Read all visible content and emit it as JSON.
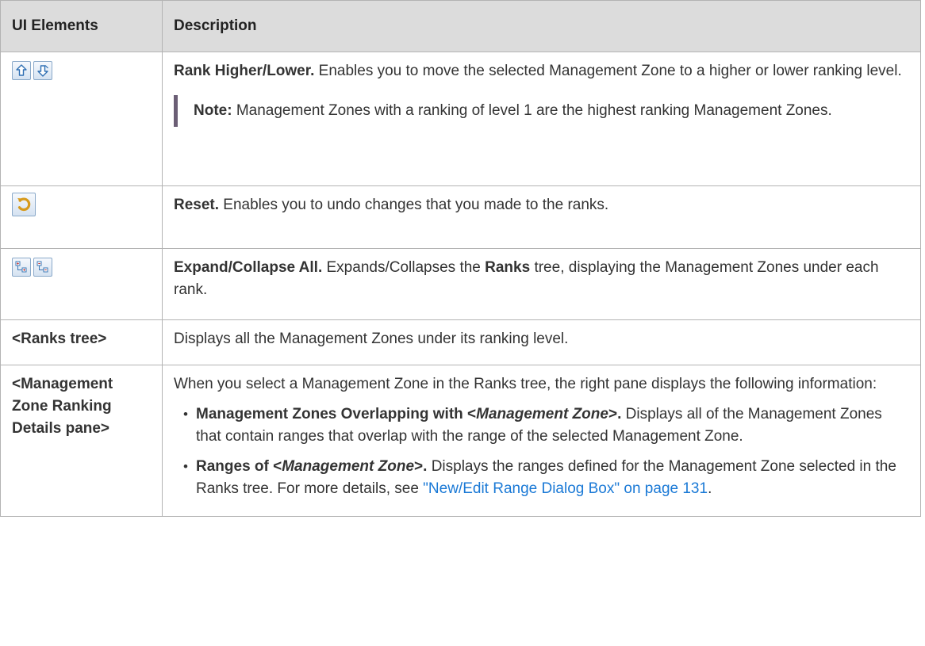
{
  "table": {
    "headers": [
      "UI Elements",
      "Description"
    ],
    "rows": [
      {
        "element_icons": [
          "rank-higher-icon",
          "rank-lower-icon"
        ],
        "title": "Rank Higher/Lower.",
        "text": " Enables you to move the selected Management Zone to a higher or lower ranking level.",
        "note_label": "Note:",
        "note_text": " Management Zones with a ranking of level 1 are the highest ranking Management Zones."
      },
      {
        "element_icons": [
          "reset-icon"
        ],
        "title": "Reset.",
        "text": " Enables you to undo changes that you made to the ranks."
      },
      {
        "element_icons": [
          "expand-all-icon",
          "collapse-all-icon"
        ],
        "title": "Expand/Collapse All.",
        "text_a": " Expands/Collapses the ",
        "text_bold": "Ranks",
        "text_b": " tree, displaying the Management Zones under each rank."
      },
      {
        "element": "<Ranks tree>",
        "text": "Displays all the Management Zones under its ranking level."
      },
      {
        "element": "<Management Zone Ranking Details pane>",
        "intro": "When you select a Management Zone in the Ranks tree, the right pane displays the following information:",
        "bullets": [
          {
            "bold_a": "Management Zones Overlapping with <",
            "italic": "Management Zone",
            "bold_b": ">.",
            "text": " Displays all of the Management Zones that contain ranges that overlap with the range of the selected Management Zone."
          },
          {
            "bold_a": "Ranges of <",
            "italic": "Management Zone",
            "bold_b": ">.",
            "text": " Displays the ranges defined for the Management Zone selected in the Ranks tree. For more details, see ",
            "link": "\"New/Edit Range Dialog Box\" on page 131",
            "after": "."
          }
        ]
      }
    ]
  }
}
